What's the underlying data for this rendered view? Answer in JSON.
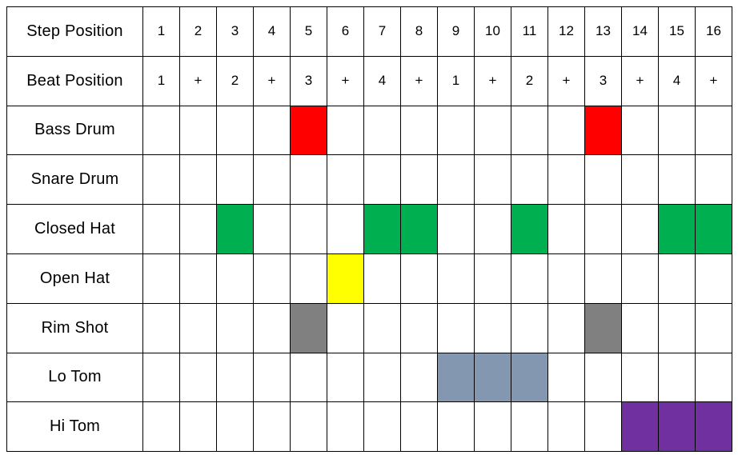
{
  "sequencer": {
    "row_labels": {
      "step_position": "Step Position",
      "beat_position": "Beat Position"
    },
    "step_positions": [
      "1",
      "2",
      "3",
      "4",
      "5",
      "6",
      "7",
      "8",
      "9",
      "10",
      "11",
      "12",
      "13",
      "14",
      "15",
      "16"
    ],
    "beat_positions": [
      "1",
      "+",
      "2",
      "+",
      "3",
      "+",
      "4",
      "+",
      "1",
      "+",
      "2",
      "+",
      "3",
      "+",
      "4",
      "+"
    ],
    "colors": {
      "bass_drum": "#FF0000",
      "snare_drum": "#FFFFFF",
      "closed_hat": "#00B050",
      "open_hat": "#FFFF00",
      "rim_shot": "#808080",
      "lo_tom": "#8497B0",
      "hi_tom": "#7030A0",
      "empty": "#FFFFFF",
      "grid_line": "#000000",
      "text": "#000000"
    },
    "tracks": [
      {
        "id": "bass-drum",
        "label": "Bass Drum",
        "color": "#FF0000",
        "steps": [
          0,
          0,
          0,
          0,
          1,
          0,
          0,
          0,
          0,
          0,
          0,
          0,
          1,
          0,
          0,
          0
        ]
      },
      {
        "id": "snare-drum",
        "label": "Snare Drum",
        "color": "#FFFFFF",
        "steps": [
          0,
          0,
          0,
          0,
          0,
          0,
          0,
          0,
          0,
          0,
          0,
          0,
          0,
          0,
          0,
          0
        ]
      },
      {
        "id": "closed-hat",
        "label": "Closed Hat",
        "color": "#00B050",
        "steps": [
          0,
          0,
          1,
          0,
          0,
          0,
          1,
          1,
          0,
          0,
          1,
          0,
          0,
          0,
          1,
          1
        ]
      },
      {
        "id": "open-hat",
        "label": "Open Hat",
        "color": "#FFFF00",
        "steps": [
          0,
          0,
          0,
          0,
          0,
          1,
          0,
          0,
          0,
          0,
          0,
          0,
          0,
          0,
          0,
          0
        ]
      },
      {
        "id": "rim-shot",
        "label": "Rim Shot",
        "color": "#808080",
        "steps": [
          0,
          0,
          0,
          0,
          1,
          0,
          0,
          0,
          0,
          0,
          0,
          0,
          1,
          0,
          0,
          0
        ]
      },
      {
        "id": "lo-tom",
        "label": "Lo Tom",
        "color": "#8497B0",
        "steps": [
          0,
          0,
          0,
          0,
          0,
          0,
          0,
          0,
          1,
          1,
          1,
          0,
          0,
          0,
          0,
          0
        ]
      },
      {
        "id": "hi-tom",
        "label": "Hi Tom",
        "color": "#7030A0",
        "steps": [
          0,
          0,
          0,
          0,
          0,
          0,
          0,
          0,
          0,
          0,
          0,
          0,
          0,
          1,
          1,
          1
        ]
      }
    ]
  }
}
